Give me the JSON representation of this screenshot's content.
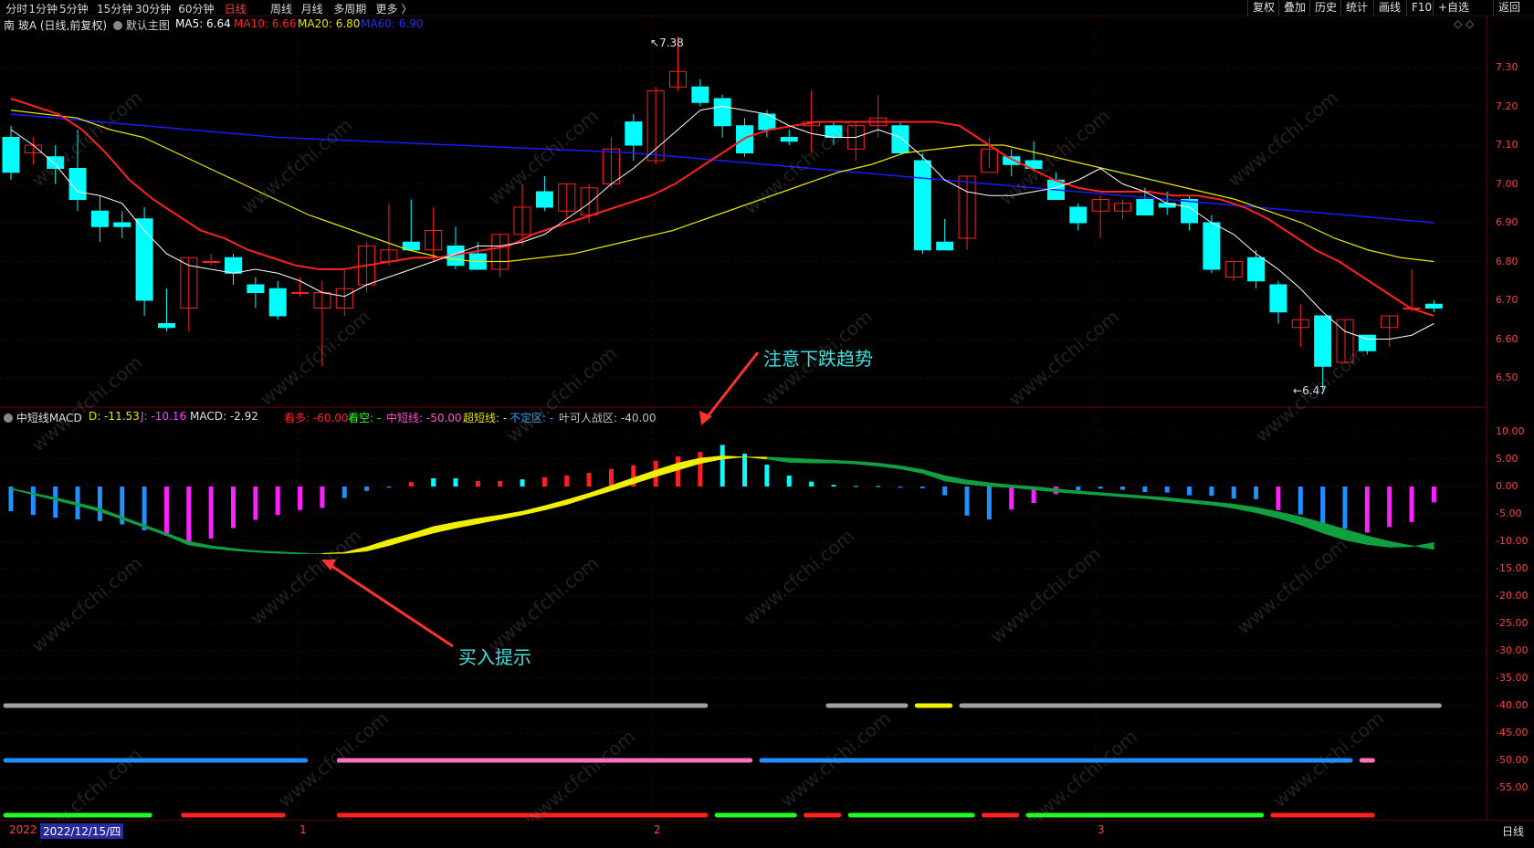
{
  "toolbar": {
    "left_items": [
      "分时",
      "1分钟",
      "5分钟",
      "15分钟",
      "30分钟",
      "60分钟",
      "日线",
      "周线",
      "月线",
      "多周期",
      "更多 〉"
    ],
    "active": "日线",
    "right_items": [
      "复权",
      "叠加",
      "历史",
      "统计",
      "画线",
      "F10",
      "+自选",
      "返回"
    ]
  },
  "main_info": {
    "stock": "南 玻A (日线,前复权)",
    "main_label": "默认主图",
    "ma5": "MA5: 6.64",
    "ma10": "MA10: 6.66",
    "ma20": "MA20: 6.80",
    "ma60": "MA60: 6.90"
  },
  "macd_info": {
    "name": "中短线MACD",
    "d": "D: -11.53",
    "j": "J: -10.16",
    "macd": "MACD: -2.92",
    "kanduo": "看多: -60.00",
    "kankong": "看空: -",
    "zhongduan": "中短线: -50.00",
    "chaoduan": "超短线: -",
    "buding": "不定区: -",
    "yeke": "叶可人战区: -40.00"
  },
  "annotations": {
    "sell": "注意下跌趋势",
    "buy": "买入提示"
  },
  "price_marks": {
    "high": "7.38",
    "low": "6.47"
  },
  "price_ticks": [
    "7.30",
    "7.20",
    "7.10",
    "7.00",
    "6.90",
    "6.80",
    "6.70",
    "6.60",
    "6.50"
  ],
  "macd_ticks": [
    "10.00",
    "5.00",
    "0.00",
    "-5.00",
    "-10.00",
    "-15.00",
    "-20.00",
    "-25.00",
    "-30.00",
    "-35.00",
    "-40.00",
    "-45.00",
    "-50.00",
    "-55.00"
  ],
  "bottom": {
    "year_label": "2022",
    "date": "2022/12/15/四",
    "month_marks": [
      "1",
      "2",
      "3"
    ],
    "period": "日线"
  },
  "watermark": "www.cfchi.com",
  "colors": {
    "up": "#ff2020",
    "down": "#00ffff",
    "ma5": "#ffffff",
    "ma10": "#ff2020",
    "ma20": "#e6e600",
    "ma60": "#1a1aff",
    "bg": "#000000"
  },
  "chart_data": {
    "type": "candlestick",
    "ohlc": [
      [
        7.12,
        7.15,
        7.01,
        7.03
      ],
      [
        7.08,
        7.12,
        7.05,
        7.1
      ],
      [
        7.07,
        7.1,
        7.0,
        7.04
      ],
      [
        7.04,
        7.14,
        6.93,
        6.96
      ],
      [
        6.93,
        6.97,
        6.85,
        6.89
      ],
      [
        6.9,
        6.93,
        6.86,
        6.89
      ],
      [
        6.91,
        6.94,
        6.66,
        6.7
      ],
      [
        6.64,
        6.73,
        6.62,
        6.63
      ],
      [
        6.68,
        6.81,
        6.62,
        6.81
      ],
      [
        6.8,
        6.82,
        6.79,
        6.8
      ],
      [
        6.81,
        6.82,
        6.74,
        6.77
      ],
      [
        6.74,
        6.76,
        6.68,
        6.72
      ],
      [
        6.73,
        6.75,
        6.65,
        6.66
      ],
      [
        6.72,
        6.76,
        6.71,
        6.72
      ],
      [
        6.68,
        6.75,
        6.53,
        6.72
      ],
      [
        6.68,
        6.78,
        6.66,
        6.73
      ],
      [
        6.74,
        6.85,
        6.72,
        6.84
      ],
      [
        6.8,
        6.95,
        6.79,
        6.83
      ],
      [
        6.85,
        6.96,
        6.84,
        6.83
      ],
      [
        6.83,
        6.94,
        6.8,
        6.88
      ],
      [
        6.84,
        6.89,
        6.78,
        6.79
      ],
      [
        6.82,
        6.85,
        6.78,
        6.78
      ],
      [
        6.78,
        6.87,
        6.76,
        6.87
      ],
      [
        6.87,
        7.0,
        6.84,
        6.94
      ],
      [
        6.98,
        7.02,
        6.93,
        6.94
      ],
      [
        6.93,
        7.0,
        6.91,
        7.0
      ],
      [
        6.92,
        7.0,
        6.9,
        6.99
      ],
      [
        7.0,
        7.12,
        6.99,
        7.09
      ],
      [
        7.16,
        7.18,
        7.06,
        7.1
      ],
      [
        7.06,
        7.25,
        7.05,
        7.24
      ],
      [
        7.25,
        7.38,
        7.24,
        7.29
      ],
      [
        7.25,
        7.27,
        7.2,
        7.21
      ],
      [
        7.22,
        7.23,
        7.12,
        7.15
      ],
      [
        7.15,
        7.17,
        7.07,
        7.08
      ],
      [
        7.18,
        7.19,
        7.12,
        7.14
      ],
      [
        7.12,
        7.14,
        7.1,
        7.11
      ],
      [
        7.15,
        7.24,
        7.08,
        7.16
      ],
      [
        7.15,
        7.16,
        7.1,
        7.12
      ],
      [
        7.09,
        7.16,
        7.06,
        7.15
      ],
      [
        7.15,
        7.23,
        7.12,
        7.17
      ],
      [
        7.15,
        7.16,
        7.08,
        7.08
      ],
      [
        7.06,
        7.08,
        6.82,
        6.83
      ],
      [
        6.85,
        6.91,
        6.83,
        6.83
      ],
      [
        6.86,
        7.02,
        6.83,
        7.02
      ],
      [
        7.03,
        7.12,
        7.04,
        7.09
      ],
      [
        7.07,
        7.09,
        7.02,
        7.05
      ],
      [
        7.06,
        7.11,
        7.05,
        7.04
      ],
      [
        7.01,
        7.03,
        6.96,
        6.96
      ],
      [
        6.94,
        6.95,
        6.88,
        6.9
      ],
      [
        6.93,
        6.97,
        6.86,
        6.96
      ],
      [
        6.93,
        6.96,
        6.91,
        6.95
      ],
      [
        6.96,
        6.99,
        6.92,
        6.92
      ],
      [
        6.95,
        6.98,
        6.92,
        6.94
      ],
      [
        6.96,
        6.97,
        6.88,
        6.9
      ],
      [
        6.9,
        6.92,
        6.77,
        6.78
      ],
      [
        6.76,
        6.8,
        6.75,
        6.8
      ],
      [
        6.81,
        6.83,
        6.73,
        6.75
      ],
      [
        6.74,
        6.75,
        6.64,
        6.67
      ],
      [
        6.63,
        6.69,
        6.58,
        6.65
      ],
      [
        6.66,
        6.66,
        6.47,
        6.53
      ],
      [
        6.54,
        6.65,
        6.54,
        6.65
      ],
      [
        6.61,
        6.61,
        6.56,
        6.57
      ],
      [
        6.63,
        6.66,
        6.58,
        6.66
      ],
      [
        6.68,
        6.78,
        6.67,
        6.68
      ],
      [
        6.69,
        6.7,
        6.67,
        6.68
      ]
    ],
    "ma5": [
      7.14,
      7.1,
      7.05,
      6.98,
      6.97,
      6.95,
      6.88,
      6.82,
      6.79,
      6.78,
      6.77,
      6.78,
      6.77,
      6.75,
      6.72,
      6.71,
      6.74,
      6.76,
      6.78,
      6.8,
      6.82,
      6.84,
      6.84,
      6.85,
      6.87,
      6.91,
      6.95,
      7.0,
      7.04,
      7.09,
      7.14,
      7.19,
      7.2,
      7.19,
      7.18,
      7.15,
      7.13,
      7.12,
      7.12,
      7.14,
      7.12,
      7.07,
      7.01,
      6.98,
      6.97,
      6.97,
      6.98,
      6.99,
      7.01,
      7.04,
      7.0,
      6.98,
      6.95,
      6.94,
      6.9,
      6.87,
      6.82,
      6.78,
      6.73,
      6.67,
      6.62,
      6.6,
      6.6,
      6.61,
      6.64
    ],
    "ma10": [
      7.22,
      7.2,
      7.18,
      7.14,
      7.08,
      7.01,
      6.96,
      6.92,
      6.88,
      6.86,
      6.83,
      6.81,
      6.79,
      6.78,
      6.78,
      6.79,
      6.8,
      6.81,
      6.81,
      6.82,
      6.83,
      6.84,
      6.87,
      6.89,
      6.91,
      6.93,
      6.95,
      6.97,
      7.0,
      7.04,
      7.08,
      7.12,
      7.14,
      7.15,
      7.16,
      7.16,
      7.16,
      7.16,
      7.16,
      7.16,
      7.15,
      7.11,
      7.07,
      7.04,
      7.01,
      6.99,
      6.98,
      6.98,
      6.98,
      6.97,
      6.97,
      6.96,
      6.94,
      6.91,
      6.87,
      6.83,
      6.8,
      6.76,
      6.72,
      6.68,
      6.66
    ],
    "ma20": [
      7.19,
      7.18,
      7.17,
      7.14,
      7.12,
      7.08,
      7.04,
      7.0,
      6.96,
      6.92,
      6.89,
      6.86,
      6.83,
      6.81,
      6.8,
      6.8,
      6.81,
      6.82,
      6.84,
      6.86,
      6.88,
      6.91,
      6.94,
      6.97,
      7.0,
      7.03,
      7.05,
      7.08,
      7.09,
      7.1,
      7.1,
      7.08,
      7.06,
      7.04,
      7.02,
      7.0,
      6.98,
      6.96,
      6.93,
      6.9,
      6.86,
      6.83,
      6.81,
      6.8
    ],
    "ma60": [
      7.18,
      7.16,
      7.14,
      7.12,
      7.11,
      7.1,
      7.09,
      7.08,
      7.06,
      7.04,
      7.02,
      7.0,
      6.98,
      6.96,
      6.94,
      6.92,
      6.9
    ],
    "macd_hist": [
      -4.5,
      -5.2,
      -5.7,
      -6.0,
      -6.3,
      -6.9,
      -8.0,
      -9.0,
      -10.4,
      -9.5,
      -7.6,
      -6.1,
      -5.2,
      -4.3,
      -3.9,
      -2.1,
      -0.8,
      -0.2,
      0.8,
      1.5,
      1.5,
      1.0,
      1.0,
      1.3,
      1.7,
      2.0,
      2.5,
      3.2,
      3.9,
      4.7,
      5.5,
      6.3,
      7.6,
      6.0,
      4.0,
      2.0,
      0.9,
      0.3,
      0.1,
      0.1,
      -0.2,
      -0.3,
      -1.6,
      -5.3,
      -6.0,
      -4.2,
      -3.0,
      -1.4,
      -0.7,
      -0.4,
      -0.6,
      -1.0,
      -1.1,
      -1.6,
      -1.7,
      -2.2,
      -2.3,
      -4.3,
      -5.1,
      -6.9,
      -7.7,
      -8.4,
      -7.4,
      -6.5,
      -2.9
    ],
    "j_line": [
      -0.5,
      -1.5,
      -2.5,
      -3.5,
      -4.6,
      -6.0,
      -7.5,
      -9.0,
      -10.7,
      -11.3,
      -11.7,
      -12.0,
      -12.2,
      -12.3,
      -12.2,
      -12.0,
      -11.0,
      -9.7,
      -8.6,
      -7.3,
      -6.5,
      -5.8,
      -5.2,
      -4.5,
      -3.5,
      -2.4,
      -1.2,
      0.2,
      1.6,
      3.0,
      4.3,
      5.2,
      5.6,
      5.4,
      5.0,
      4.4,
      4.3,
      4.3,
      4.1,
      3.7,
      3.2,
      2.4,
      1.0,
      0.4,
      0.0,
      -0.2,
      -0.6,
      -1.0,
      -1.3,
      -1.6,
      -1.9,
      -2.2,
      -2.6,
      -3.0,
      -3.4,
      -4.0,
      -4.8,
      -5.8,
      -7.0,
      -8.5,
      -9.8,
      -10.6,
      -11.1,
      -11.0,
      -10.2
    ],
    "d_line": [
      -0.3,
      -1.2,
      -2.0,
      -3.0,
      -4.0,
      -5.5,
      -7.0,
      -8.5,
      -10.0,
      -10.8,
      -11.3,
      -11.7,
      -11.9,
      -12.1,
      -12.3,
      -12.2,
      -11.8,
      -10.8,
      -9.6,
      -8.5,
      -7.6,
      -6.8,
      -6.0,
      -5.2,
      -4.3,
      -3.3,
      -2.0,
      -0.8,
      0.5,
      1.8,
      3.0,
      4.2,
      5.0,
      5.4,
      5.4,
      5.2,
      5.0,
      4.8,
      4.6,
      4.3,
      3.8,
      3.1,
      2.0,
      1.2,
      0.7,
      0.3,
      0.0,
      -0.4,
      -0.8,
      -1.1,
      -1.4,
      -1.7,
      -2.0,
      -2.4,
      -2.8,
      -3.2,
      -3.8,
      -4.6,
      -5.5,
      -6.6,
      -7.8,
      -9.0,
      -10.0,
      -10.8,
      -11.5
    ],
    "signal_rows": [
      {
        "value": -40,
        "segments": [
          [
            "gray",
            0,
            31
          ],
          [
            "gray",
            37,
            40
          ],
          [
            "yellow",
            41,
            42
          ],
          [
            "gray",
            43,
            64
          ]
        ]
      },
      {
        "value": -50,
        "segments": [
          [
            "blue",
            0,
            13
          ],
          [
            "pink",
            15,
            33
          ],
          [
            "blue",
            34,
            60
          ],
          [
            "pink",
            61,
            61
          ]
        ]
      },
      {
        "value": -60,
        "segments": [
          [
            "green",
            0,
            6
          ],
          [
            "red",
            8,
            12
          ],
          [
            "red",
            15,
            31
          ],
          [
            "green",
            32,
            35
          ],
          [
            "red",
            36,
            37
          ],
          [
            "green",
            38,
            43
          ],
          [
            "red",
            44,
            45
          ],
          [
            "green",
            46,
            56
          ],
          [
            "red",
            57,
            61
          ]
        ]
      }
    ]
  }
}
